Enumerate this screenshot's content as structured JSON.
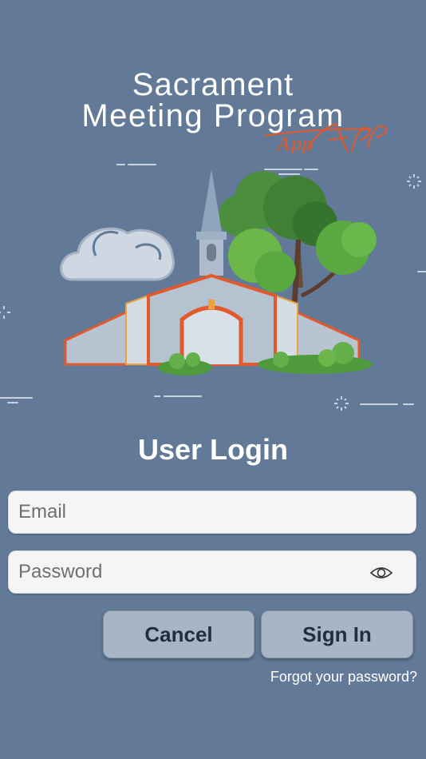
{
  "header": {
    "title_line1": "Sacrament",
    "title_line2": "Meeting Program",
    "app_script": "App"
  },
  "hero": {
    "illustration": "church-with-trees-illustration"
  },
  "login": {
    "title": "User Login",
    "email_placeholder": "Email",
    "password_placeholder": "Password",
    "cancel_label": "Cancel",
    "signin_label": "Sign In",
    "forgot_label": "Forgot your password?"
  },
  "colors": {
    "background": "#627a97",
    "button": "#a7b5c4",
    "button_text": "#1f2f42",
    "accent_red": "#e25a2c",
    "field_bg": "#f5f5f5"
  },
  "icons": {
    "password_toggle": "eye-icon"
  }
}
